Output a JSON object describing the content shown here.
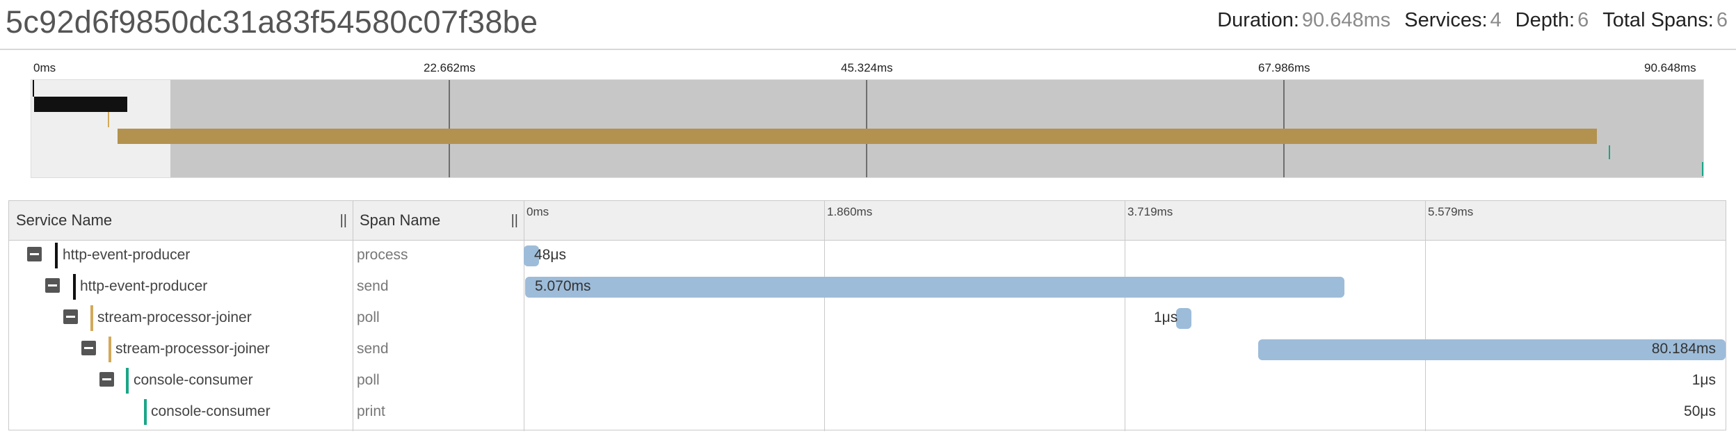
{
  "trace": {
    "id": "5c92d6f9850dc31a83f54580c07f38be",
    "stats": [
      {
        "label": "Duration:",
        "value": "90.648ms"
      },
      {
        "label": "Services:",
        "value": "4"
      },
      {
        "label": "Depth:",
        "value": "6"
      },
      {
        "label": "Total Spans:",
        "value": "6"
      }
    ]
  },
  "minimap": {
    "ticks": [
      "0ms",
      "22.662ms",
      "45.324ms",
      "67.986ms",
      "90.648ms"
    ]
  },
  "table": {
    "columns": {
      "service": "Service Name",
      "span": "Span Name",
      "resize_handle": "||"
    },
    "timeline_ticks": [
      "0ms",
      "1.860ms",
      "3.719ms",
      "5.579ms"
    ],
    "rows": [
      {
        "service": "http-event-producer",
        "span": "process",
        "duration": "48μs",
        "color": "#111111"
      },
      {
        "service": "http-event-producer",
        "span": "send",
        "duration": "5.070ms",
        "color": "#111111"
      },
      {
        "service": "stream-processor-joiner",
        "span": "poll",
        "duration": "1μs",
        "color": "#d2a95a"
      },
      {
        "service": "stream-processor-joiner",
        "span": "send",
        "duration": "80.184ms",
        "color": "#d2a95a"
      },
      {
        "service": "console-consumer",
        "span": "poll",
        "duration": "1μs",
        "color": "#1aa687"
      },
      {
        "service": "console-consumer",
        "span": "print",
        "duration": "50μs",
        "color": "#1aa687"
      }
    ]
  },
  "colors": {
    "span_bar": "#9dbcd9",
    "minimap_dark": "#111111",
    "minimap_gold": "#b3924f",
    "minimap_teal": "#1aa687"
  }
}
